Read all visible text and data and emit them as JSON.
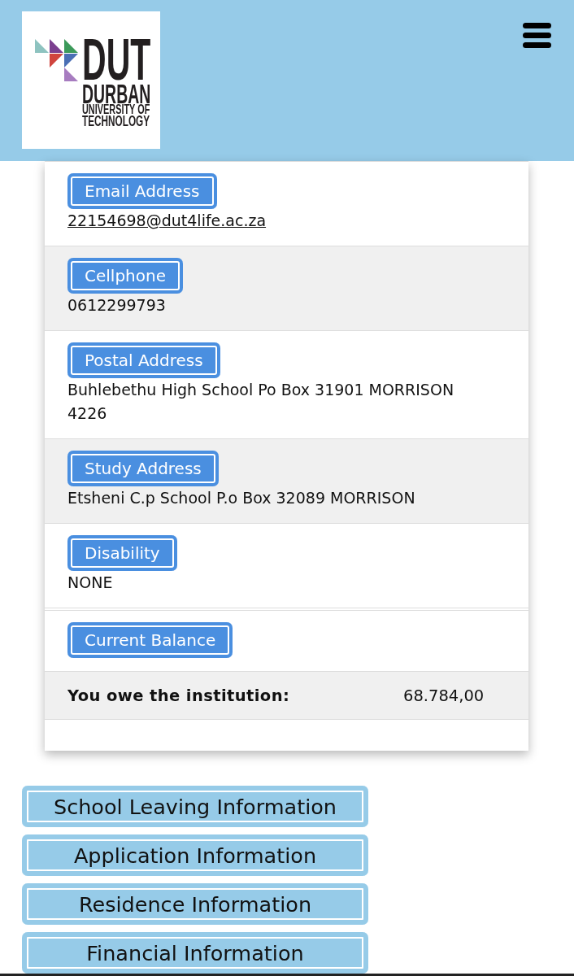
{
  "header": {
    "logo": {
      "title": "DUT",
      "lines": [
        "DURBAN",
        "UNIVERSITY OF",
        "TECHNOLOGY"
      ]
    }
  },
  "details": [
    {
      "label": "Email Address",
      "value": "22154698@dut4life.ac.za",
      "kind": "link"
    },
    {
      "label": "Cellphone",
      "value": "0612299793",
      "kind": "text"
    },
    {
      "label": "Postal Address",
      "value": "Buhlebethu High School Po Box 31901 MORRISON 4226",
      "kind": "text"
    },
    {
      "label": "Study Address",
      "value": "Etsheni C.p School P.o Box 32089 MORRISON",
      "kind": "text"
    },
    {
      "label": "Disability",
      "value": "NONE",
      "kind": "text"
    }
  ],
  "balance": {
    "label": "Current Balance",
    "description": "You owe the institution:",
    "amount": "68.784,00"
  },
  "sections": [
    "School Leaving Information",
    "Application Information",
    "Residence Information",
    "Financial Information"
  ]
}
